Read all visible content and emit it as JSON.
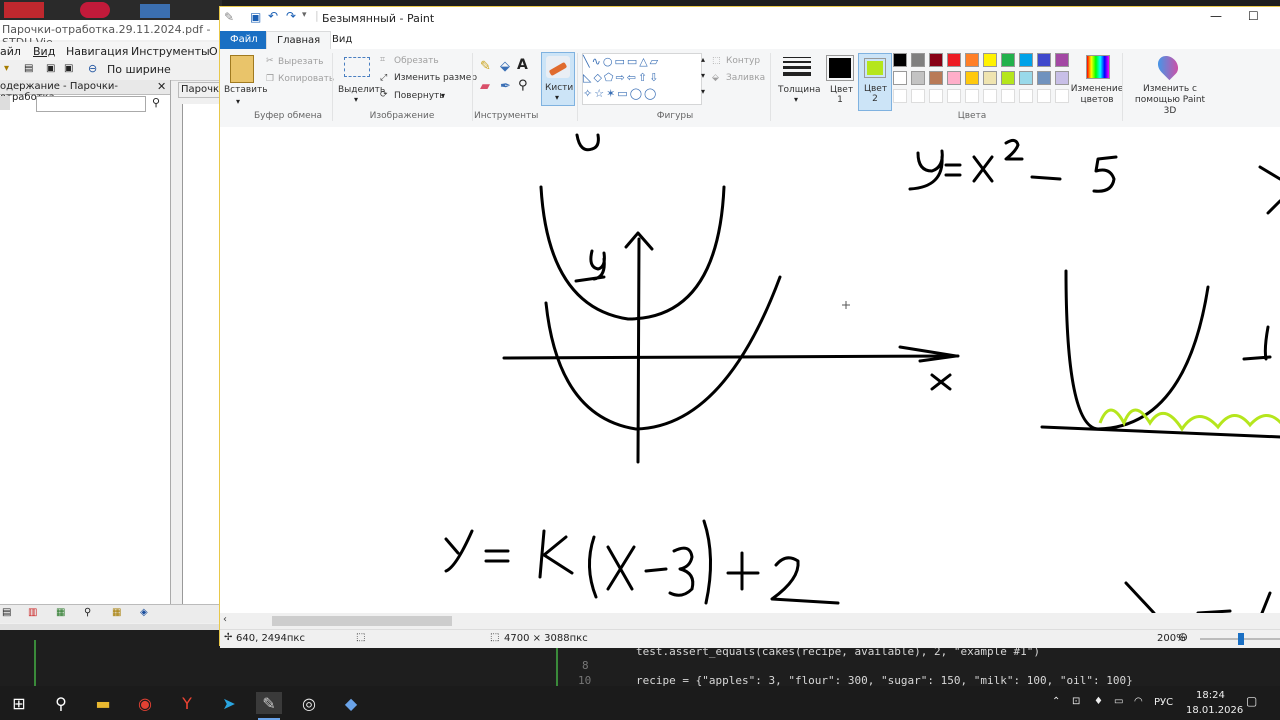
{
  "stdu": {
    "title": "Парочки-отработка.29.11.2024.pdf - STDU Vie",
    "menu": [
      "айл",
      "Вид",
      "Навигация",
      "Инструменты",
      "О"
    ],
    "fit_label": "По ширине",
    "sidebar_title": "одержание - Парочки-отработка",
    "doc_tab": "Парочк"
  },
  "paint": {
    "window_title": "Безымянный - Paint",
    "tabs": {
      "file": "Файл",
      "home": "Главная",
      "view": "Вид"
    },
    "ribbon": {
      "paste": "Вставить",
      "cut": "Вырезать",
      "copy": "Копировать",
      "clipboard_group": "Буфер обмена",
      "select": "Выделить",
      "crop": "Обрезать",
      "resize": "Изменить размер",
      "rotate": "Повернуть",
      "image_group": "Изображение",
      "tools_group": "Инструменты",
      "brushes": "Кисти",
      "outline": "Контур",
      "fill": "Заливка",
      "shapes_group": "Фигуры",
      "size": "Толщина",
      "color1": "Цвет 1",
      "color2": "Цвет 2",
      "edit_colors": "Изменение цветов",
      "paint3d": "Изменить с помощью Paint 3D",
      "colors_group": "Цвета"
    },
    "palette": [
      "#000000",
      "#7f7f7f",
      "#880015",
      "#ed1c24",
      "#ff7f27",
      "#fff200",
      "#22b14c",
      "#00a2e8",
      "#3f48cc",
      "#a349a4",
      "#ffffff",
      "#c3c3c3",
      "#b97a57",
      "#ffaec9",
      "#ffc90e",
      "#efe4b0",
      "#b5e61d",
      "#99d9ea",
      "#7092be",
      "#c8bfe7"
    ],
    "color1_value": "#000000",
    "color2_value": "#b5e61d",
    "canvas_text": {
      "eq1": "y = x² − 5",
      "eq2": "Y = K(X − 3) + 2",
      "axis_x": "x"
    },
    "status": {
      "cursor": "640, 2494пкс",
      "dimensions": "4700 × 3088пкс",
      "zoom": "200%"
    }
  },
  "editor": {
    "line8": "test.assert_equals(cakes(recipe, available), 2, \"example #1\")",
    "line10": "recipe = {\"apples\": 3, \"flour\": 300, \"sugar\": 150, \"milk\": 100, \"oil\": 100}",
    "ln8": "8",
    "ln10": "10"
  },
  "taskbar": {
    "lang": "РУС",
    "time": "18:24",
    "date": "18.01.2026"
  }
}
